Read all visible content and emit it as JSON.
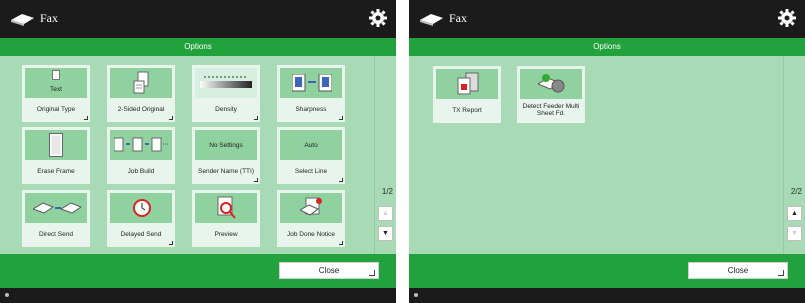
{
  "left": {
    "app_title": "Fax",
    "options_header": "Options",
    "page_indicator": "1/2",
    "close_label": "Close",
    "tiles": [
      {
        "label": "Original Type",
        "art_text": "Text"
      },
      {
        "label": "2-Sided Original",
        "art_text": ""
      },
      {
        "label": "Density",
        "art_text": ""
      },
      {
        "label": "Sharpness",
        "art_text": ""
      },
      {
        "label": "Erase Frame",
        "art_text": ""
      },
      {
        "label": "Job Build",
        "art_text": ""
      },
      {
        "label": "Sender Name (TTI)",
        "art_text": "No Settings"
      },
      {
        "label": "Select Line",
        "art_text": "Auto"
      },
      {
        "label": "Direct Send",
        "art_text": ""
      },
      {
        "label": "Delayed Send",
        "art_text": ""
      },
      {
        "label": "Preview",
        "art_text": ""
      },
      {
        "label": "Job Done Notice",
        "art_text": ""
      }
    ]
  },
  "right": {
    "app_title": "Fax",
    "options_header": "Options",
    "page_indicator": "2/2",
    "close_label": "Close",
    "tiles": [
      {
        "label": "TX Report",
        "art_text": ""
      },
      {
        "label": "Detect Feeder Multi Sheet Fd.",
        "art_text": ""
      }
    ]
  },
  "colors": {
    "accent_green": "#22a23c",
    "panel_green": "#a8dbb5",
    "tile_art_green": "#8fd19f"
  }
}
